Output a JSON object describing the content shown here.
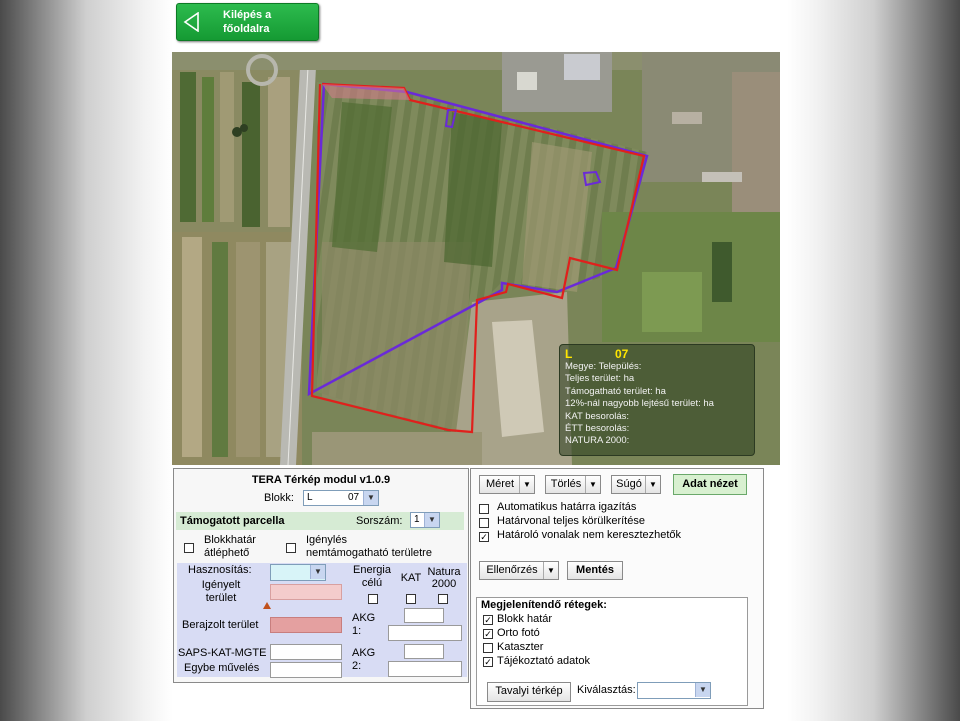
{
  "back_button": {
    "label": "Kilépés a\nfőoldalra"
  },
  "infobox": {
    "block_code": "L",
    "block_num": "07",
    "lines": [
      "Megye: Település:",
      "Teljes terület: ha",
      "Támogatható terület: ha",
      "12%-nál nagyobb lejtésű terület: ha",
      "KAT besorolás:",
      "ÉTT besorolás:",
      "NATURA 2000:"
    ]
  },
  "left": {
    "title": "TERA Térkép modul v1.0.9",
    "block_label": "Blokk:",
    "block_select": {
      "value": "L",
      "num": "07"
    },
    "supported_parcel": "Támogatott parcella",
    "serial_label": "Sorszám:",
    "serial_value": "1",
    "block_border_label": "Blokkhatár\nátléphető",
    "claim_label": "Igénylés\nnemtámogatható területre",
    "usage_label": "Hasznosítás:",
    "energy_label": "Energia\ncélú",
    "kat_label": "KAT",
    "natura_label": "Natura\n2000",
    "claimed_label": "Igényelt\nterület",
    "drawn_label": "Berajzolt terület",
    "akg1_label": "AKG\n1:",
    "saps_label": "SAPS-KAT-MGTE",
    "other_label": "Egybe művelés",
    "akg2_label": "AKG\n2:"
  },
  "right": {
    "size_btn": "Méret",
    "delete_btn": "Törlés",
    "help_btn": "Súgó",
    "data_view_btn": "Adat nézet",
    "options": [
      {
        "label": "Automatikus határra igazítás",
        "checked": false
      },
      {
        "label": "Határvonal teljes körülkerítése",
        "checked": false
      },
      {
        "label": "Határoló vonalak nem keresztezhetők",
        "checked": true
      }
    ],
    "check_btn": "Ellenőrzés",
    "save_btn": "Mentés",
    "layers_title": "Megjelenítendő rétegek:",
    "layers": [
      {
        "label": "Blokk határ",
        "checked": true
      },
      {
        "label": "Orto fotó",
        "checked": true
      },
      {
        "label": "Kataszter",
        "checked": false
      },
      {
        "label": "Tájékoztató adatok",
        "checked": true
      }
    ],
    "last_year_btn": "Tavalyi térkép",
    "select_label": "Kiválasztás:"
  },
  "colors": {
    "block_boundary": "#e0201c",
    "parcel_boundary": "#6a2ad8",
    "info_title": "#ffe600",
    "button_green": "#1aa33c"
  }
}
